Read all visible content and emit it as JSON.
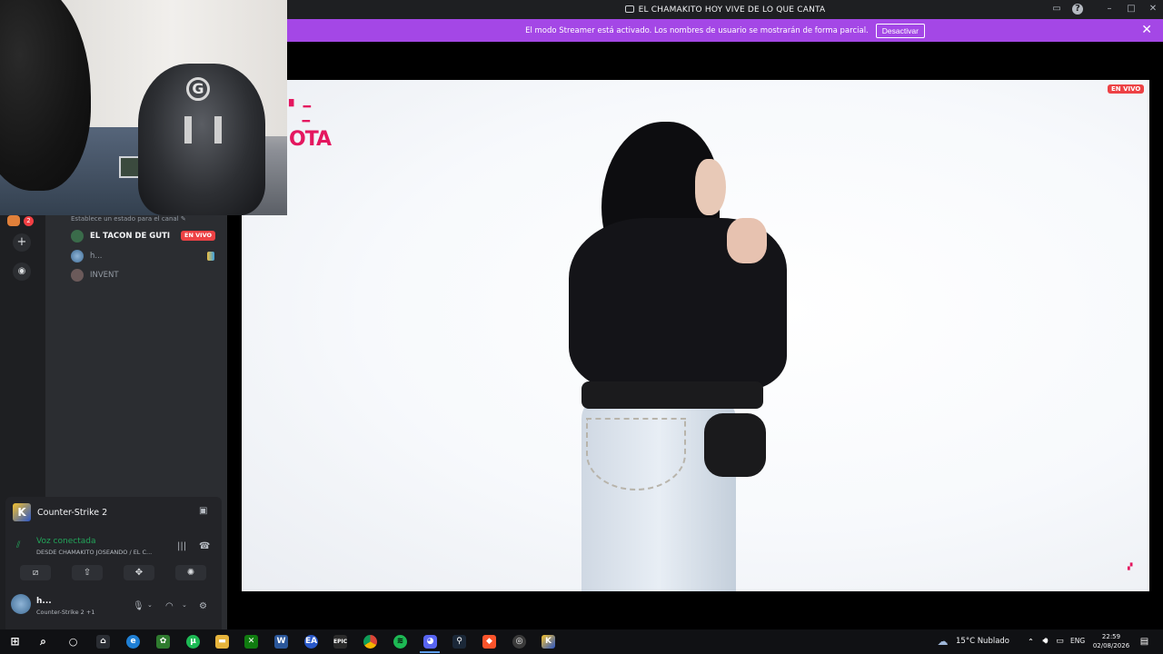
{
  "window": {
    "title": "EL CHAMAKITO HOY VIVE DE LO QUE CANTA"
  },
  "banner": {
    "message": "El modo Streamer está activado. Los nombres de usuario se mostrarán de forma parcial.",
    "deactivate_label": "Desactivar"
  },
  "sidebar": {
    "rail_badge": "2",
    "status_placeholder": "Establece un estado para el canal",
    "members": [
      {
        "name": "EL TACON DE GUTI",
        "live": "EN VIVO"
      },
      {
        "name": "h..."
      },
      {
        "name": "INVENT"
      }
    ]
  },
  "activity": {
    "game": "Counter-Strike 2"
  },
  "voice": {
    "status": "Voz conectada",
    "channel": "DESDE CHAMAKITO JOSEANDO / EL C..."
  },
  "user": {
    "name": "h...",
    "activity": "Counter-Strike 2 +1"
  },
  "stream": {
    "live_badge": "EN VIVO",
    "overlay_text": "OTA"
  },
  "taskbar": {
    "weather": "15°C  Nublado",
    "language": "ENG",
    "time": "22:59",
    "date": "02/08/2026"
  },
  "colors": {
    "banner": "#a447e6",
    "live": "#ed4245",
    "voice_connected": "#23a55a",
    "accent_pink": "#e4175f"
  },
  "icons": [
    "tv-icon",
    "inbox-icon",
    "help-icon",
    "minimize-icon",
    "maximize-icon",
    "close-icon",
    "add-server-icon",
    "discover-icon",
    "broadcast-icon",
    "signal-icon",
    "disconnect-icon",
    "mic-icon",
    "headphones-icon",
    "settings-icon",
    "windows-start-icon",
    "search-icon"
  ]
}
